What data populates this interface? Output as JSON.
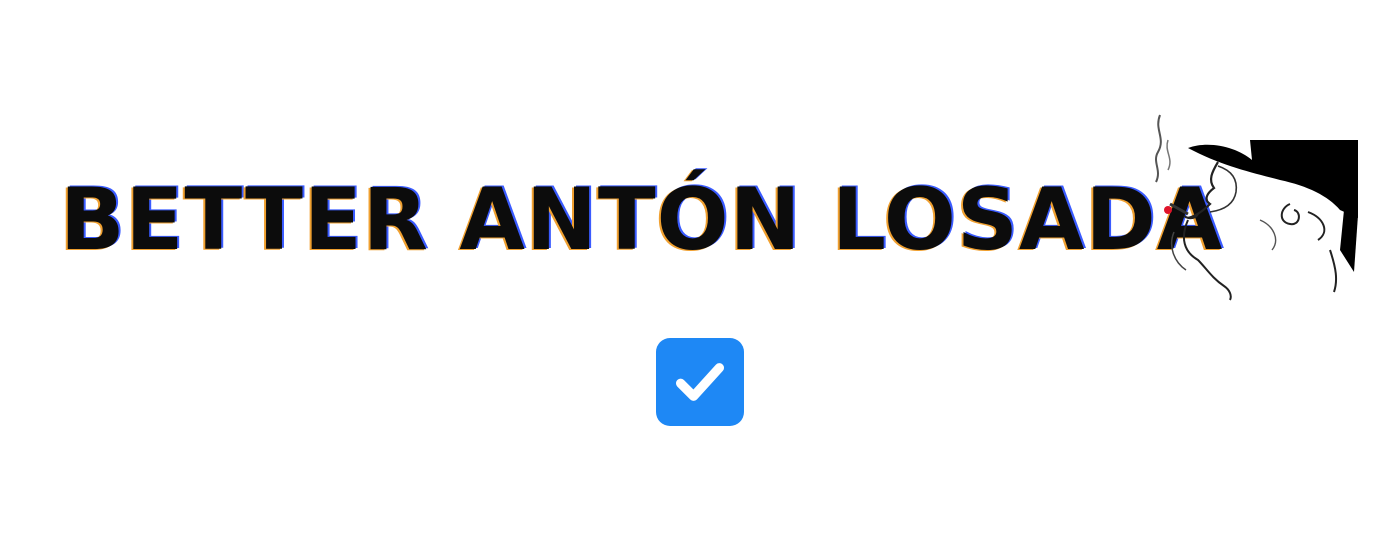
{
  "header": {
    "title": "BETTER ANTÓN LOSADA",
    "logo_icon": "smoking-man-hat-logo"
  },
  "checkbox": {
    "checked": true,
    "icon": "checkmark-icon",
    "color": "#1e88f5"
  }
}
